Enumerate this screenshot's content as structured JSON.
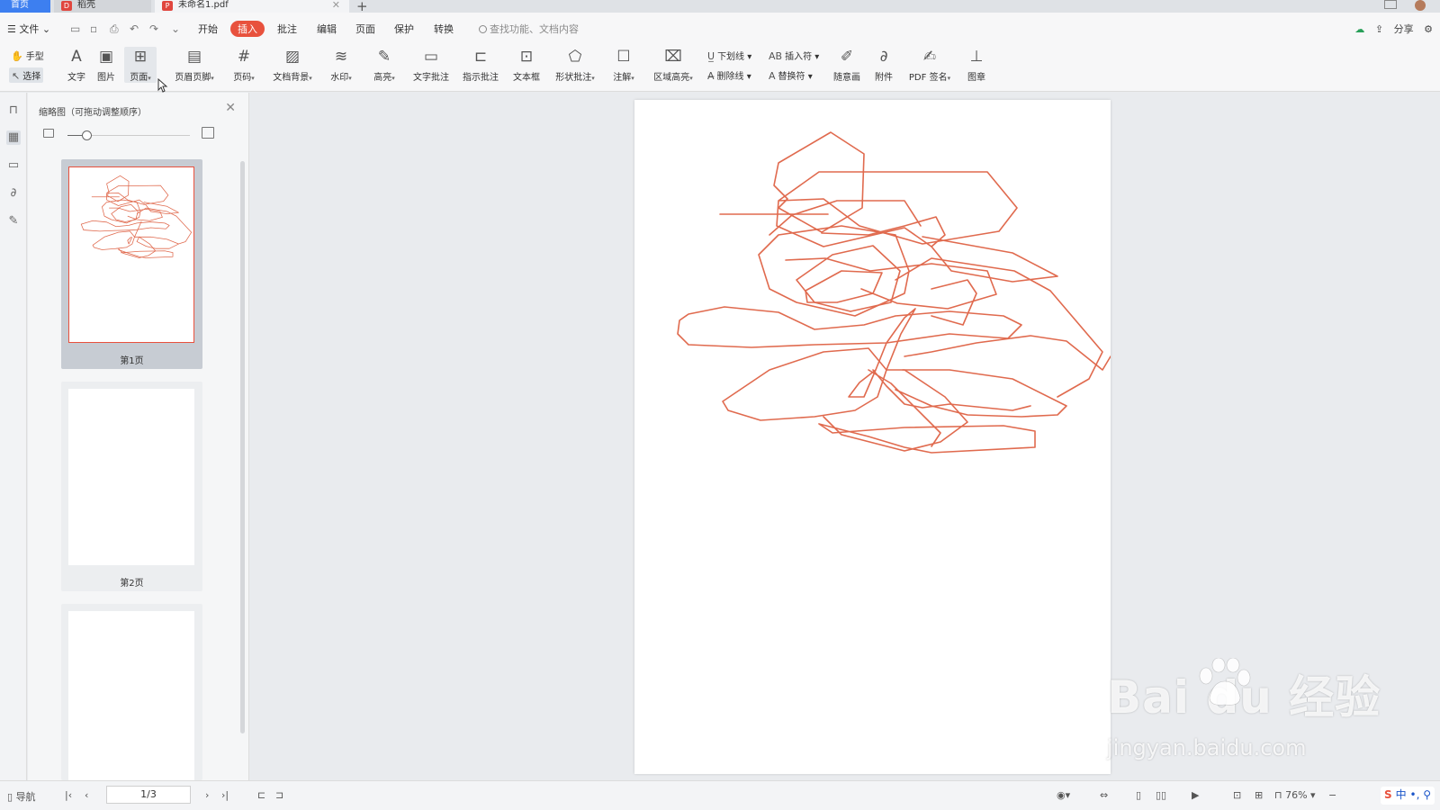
{
  "tabs": {
    "home": "首页",
    "draft": "稻壳",
    "doc": "未命名1.pdf"
  },
  "menu": {
    "file": "文件",
    "items": [
      "开始",
      "插入",
      "批注",
      "编辑",
      "页面",
      "保护",
      "转换"
    ],
    "active": "插入",
    "search_placeholder": "查找功能、文档内容",
    "share": "分享"
  },
  "ribbon": {
    "hand": "手型",
    "select": "选择",
    "text": "文字",
    "image": "图片",
    "page": "页面",
    "header_footer": "页眉页脚",
    "page_number": "页码",
    "background": "文档背景",
    "watermark": "水印",
    "highlight": "高亮",
    "text_comment": "文字批注",
    "callout_comment": "指示批注",
    "textbox": "文本框",
    "shape_comment": "形状批注",
    "note": "注解",
    "area_highlight": "区域高亮",
    "underline": "下划线",
    "strikethrough": "删除线",
    "insert_symbol": "插入符",
    "replace_symbol": "替换符",
    "freehand": "随意画",
    "attachment": "附件",
    "pdf_sign": "PDF 签名",
    "stamp": "图章"
  },
  "thumbnails": {
    "title": "缩略图（可拖动调整顺序）",
    "pages": [
      {
        "label": "第1页"
      },
      {
        "label": "第2页"
      },
      {
        "label": ""
      }
    ]
  },
  "status": {
    "nav": "导航",
    "page_indicator": "1/3",
    "zoom": "76%",
    "ime": "中"
  },
  "watermark": {
    "logo": "Bai  du 经验",
    "url": "jingyan.baidu.com"
  },
  "colors": {
    "accent": "#e8513d",
    "ink": "#e06a4e",
    "tab_home": "#3d7ff0"
  }
}
